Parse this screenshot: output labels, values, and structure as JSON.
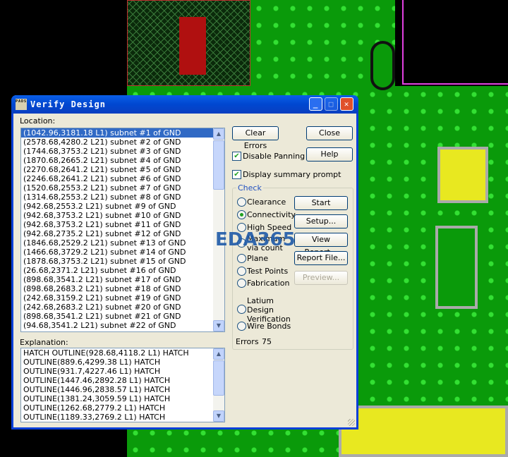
{
  "window": {
    "title": "Verify Design",
    "app_icon": "PADS"
  },
  "location": {
    "label": "Location:",
    "items": [
      "(1042.96,3181.18 L1) subnet #1 of GND",
      "(2578.68,4280.2 L21) subnet #2 of GND",
      "(1744.68,3753.2 L21) subnet #3 of GND",
      "(1870.68,2665.2 L21) subnet #4 of GND",
      "(2270.68,2641.2 L21) subnet #5 of GND",
      "(2246.68,2641.2 L21) subnet #6 of GND",
      "(1520.68,2553.2 L21) subnet #7 of GND",
      "(1314.68,2553.2 L21) subnet #8 of GND",
      "(942.68,2553.2 L21) subnet #9 of GND",
      "(942.68,3753.2 L21) subnet #10 of GND",
      "(942.68,3753.2 L21) subnet #11 of GND",
      "(942.68,2735.2 L21) subnet #12 of GND",
      "(1846.68,2529.2 L21) subnet #13 of GND",
      "(1466.68,3729.2 L21) subnet #14 of GND",
      "(1878.68,3753.2 L21) subnet #15 of GND",
      "(26.68,2371.2 L21) subnet #16 of GND",
      "(898.68,3541.2 L21) subnet #17 of GND",
      "(898.68,2683.2 L21) subnet #18 of GND",
      "(242.68,3159.2 L21) subnet #19 of GND",
      "(242.68,2683.2 L21) subnet #20 of GND",
      "(898.68,3541.2 L21) subnet #21 of GND",
      "(94.68,3541.2 L21) subnet #22 of GND"
    ]
  },
  "explanation": {
    "label": "Explanation:",
    "items": [
      "HATCH OUTLINE(928.68,4118.2 L1) HATCH",
      "OUTLINE(889.6,4299.38 L1) HATCH",
      "OUTLINE(931.7,4227.46 L1) HATCH",
      "OUTLINE(1447.46,2892.28 L1) HATCH",
      "OUTLINE(1446.96,2838.57 L1) HATCH",
      "OUTLINE(1381.24,3059.59 L1) HATCH",
      "OUTLINE(1262.68,2779.2 L1) HATCH",
      "OUTLINE(1189.33,2769.2 L1) HATCH"
    ]
  },
  "buttons": {
    "clear_errors": "Clear Errors",
    "close": "Close",
    "help": "Help",
    "start": "Start",
    "setup": "Setup...",
    "view_report": "View Report...",
    "report_file": "Report File...",
    "preview": "Preview..."
  },
  "options": {
    "disable_panning": "Disable Panning",
    "display_summary": "Display summary prompt"
  },
  "check": {
    "label": "Check",
    "radios": [
      "Clearance",
      "Connectivity",
      "High Speed",
      "Maximum via count",
      "Plane",
      "Test Points",
      "Fabrication",
      "Latium Design Verification",
      "Wire Bonds"
    ],
    "selected": 1
  },
  "errors": {
    "label": "Errors",
    "count": "75"
  },
  "watermark": "EDA365"
}
